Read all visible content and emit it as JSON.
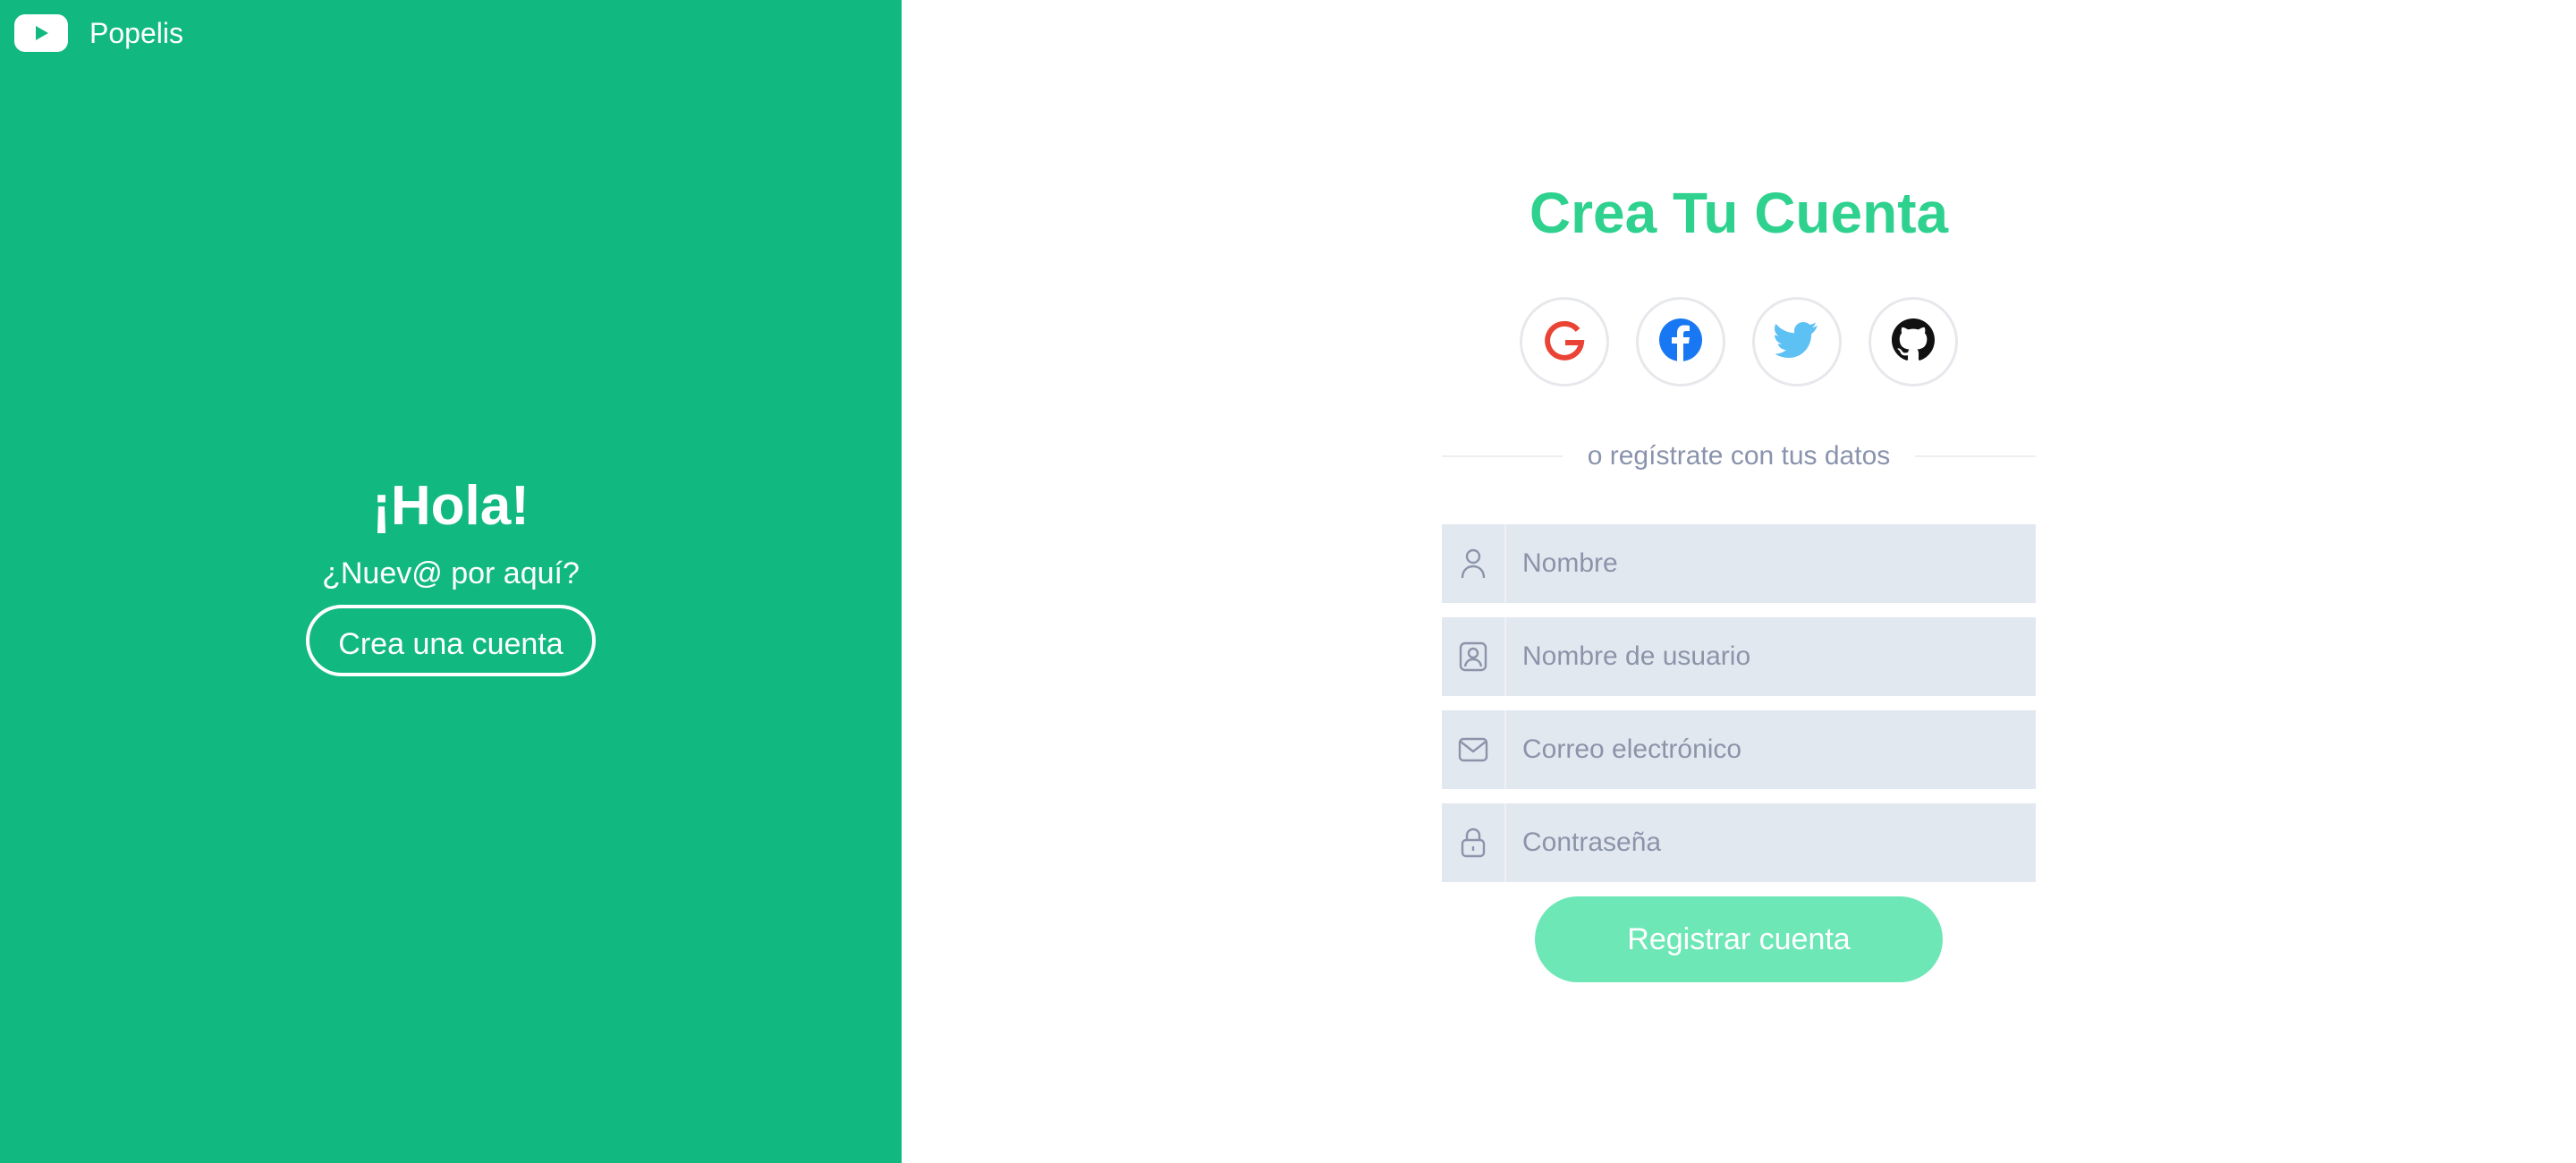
{
  "brand": {
    "name": "Popelis",
    "logo_icon": "play-icon"
  },
  "welcome": {
    "title": "¡Hola!",
    "subtitle": "¿Nuev@ por aquí?",
    "button_label": "Crea una cuenta"
  },
  "form": {
    "title": "Crea Tu Cuenta",
    "social": [
      {
        "name": "google",
        "icon": "google-icon"
      },
      {
        "name": "facebook",
        "icon": "facebook-icon"
      },
      {
        "name": "twitter",
        "icon": "twitter-icon"
      },
      {
        "name": "github",
        "icon": "github-icon"
      }
    ],
    "divider_text": "o regístrate con tus datos",
    "fields": [
      {
        "placeholder": "Nombre",
        "value": "",
        "icon": "user-icon"
      },
      {
        "placeholder": "Nombre de usuario",
        "value": "",
        "icon": "id-card-icon"
      },
      {
        "placeholder": "Correo electrónico",
        "value": "",
        "icon": "mail-icon"
      },
      {
        "placeholder": "Contraseña",
        "value": "",
        "icon": "lock-icon"
      }
    ],
    "submit_label": "Registrar cuenta"
  },
  "colors": {
    "left_panel": "#11b981",
    "title": "#2fd18e",
    "submit_button": "#6ee7b7",
    "field_bg": "#e2e8f0",
    "google": "#ea4335",
    "facebook": "#1877f2",
    "twitter": "#5ec1f4",
    "github": "#111111"
  }
}
